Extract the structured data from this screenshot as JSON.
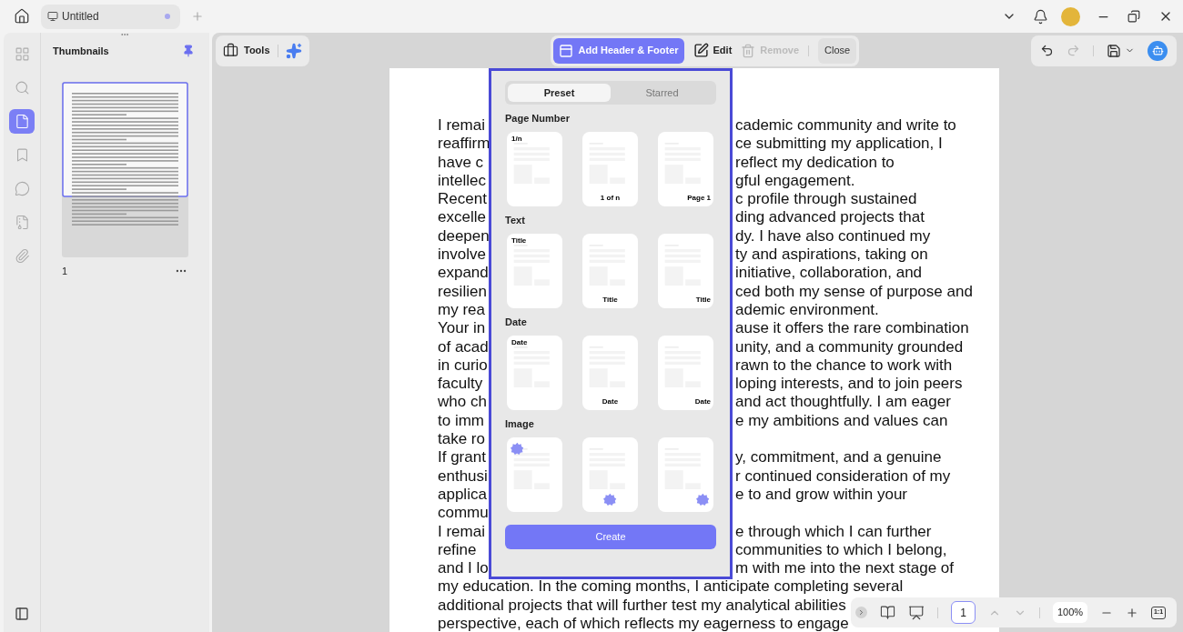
{
  "tab": {
    "title": "Untitled",
    "modified": true
  },
  "rail": [
    {
      "selected": false
    },
    {
      "selected": false
    },
    {
      "selected": true
    },
    {
      "selected": false
    },
    {
      "selected": false
    },
    {
      "selected": false
    },
    {
      "selected": false
    }
  ],
  "thumbnails": {
    "title": "Thumbnails",
    "pages": [
      {
        "number": "1",
        "selected": true
      }
    ]
  },
  "toolbar": {
    "tools": "Tools",
    "add": {
      "label": "Add Header & Footer",
      "selected": true
    },
    "edit": {
      "label": "Edit",
      "disabled": false
    },
    "remove": {
      "label": "Remove",
      "disabled": true
    },
    "close": "Close"
  },
  "panel": {
    "tabs": [
      {
        "label": "Preset",
        "selected": true
      },
      {
        "label": "Starred",
        "selected": false
      }
    ],
    "sections": [
      {
        "title": "Page Number",
        "templates": [
          {
            "kind": "label-left",
            "label": "1/n"
          },
          {
            "kind": "label-center",
            "label": "1 of n"
          },
          {
            "kind": "label-right",
            "label": "Page 1"
          }
        ]
      },
      {
        "title": "Text",
        "templates": [
          {
            "kind": "label-left",
            "label": "Title"
          },
          {
            "kind": "label-center",
            "label": "Title"
          },
          {
            "kind": "label-right",
            "label": "Title"
          }
        ]
      },
      {
        "title": "Date",
        "templates": [
          {
            "kind": "label-left",
            "label": "Date"
          },
          {
            "kind": "label-center",
            "label": "Date"
          },
          {
            "kind": "label-right",
            "label": "Date"
          }
        ]
      },
      {
        "title": "Image",
        "templates": [
          {
            "kind": "image-left"
          },
          {
            "kind": "image-center"
          },
          {
            "kind": "image-right"
          }
        ]
      }
    ],
    "button": "Create"
  },
  "document": {
    "lines": [
      {
        "left": "I remai",
        "right": "cademic community and write to"
      },
      {
        "left": "reaffirm",
        "right": "ce submitting my application, I"
      },
      {
        "left": "have c",
        "right": "reflect my dedication to"
      },
      {
        "left": "intellec",
        "right": "gful engagement."
      },
      {
        "left": "Recent",
        "right": "c profile through sustained"
      },
      {
        "left": "excelle",
        "right": "ding advanced projects that"
      },
      {
        "left": "deepen",
        "right": "dy. I have also continued my"
      },
      {
        "left": "involve",
        "right": "ty and aspirations, taking on"
      },
      {
        "left": "expand",
        "right": "initiative, collaboration, and"
      },
      {
        "left": "resilien",
        "right": "ced both my sense of purpose and"
      },
      {
        "left": "my rea",
        "right": "ademic environment."
      },
      {
        "left": "Your in",
        "right": "ause it offers the rare combination"
      },
      {
        "left": "of acad",
        "right": "unity, and a community grounded"
      },
      {
        "left": "in curio",
        "right": "rawn to the chance to work with"
      },
      {
        "left": "faculty",
        "right": "loping interests, and to join peers"
      },
      {
        "left": "who ch",
        "right": "and act thoughtfully. I am eager"
      },
      {
        "left": "to imm",
        "right": "e my ambitions and values can"
      },
      {
        "left": "take ro"
      },
      {
        "left": "If grant",
        "right": "y, commitment, and a genuine"
      },
      {
        "left": "enthusi",
        "right": "r continued consideration of my"
      },
      {
        "left": "applica",
        "right": "e to and grow within your"
      },
      {
        "left": "commu"
      },
      {
        "left": "I remai",
        "right": "e through which I can further"
      },
      {
        "left": "refine",
        "right": "communities to which I belong,"
      },
      {
        "left": "and I lo",
        "right": "m with me into the next stage of"
      },
      {
        "text": "my education. In the coming months, I anticipate completing several"
      },
      {
        "text": "additional projects that will further test my analytical abilities"
      },
      {
        "text": "perspective, each of which reflects my eagerness to engage"
      }
    ]
  },
  "page_nav": {
    "page": "1",
    "zoom": "100%",
    "actual_size": "1:1"
  }
}
